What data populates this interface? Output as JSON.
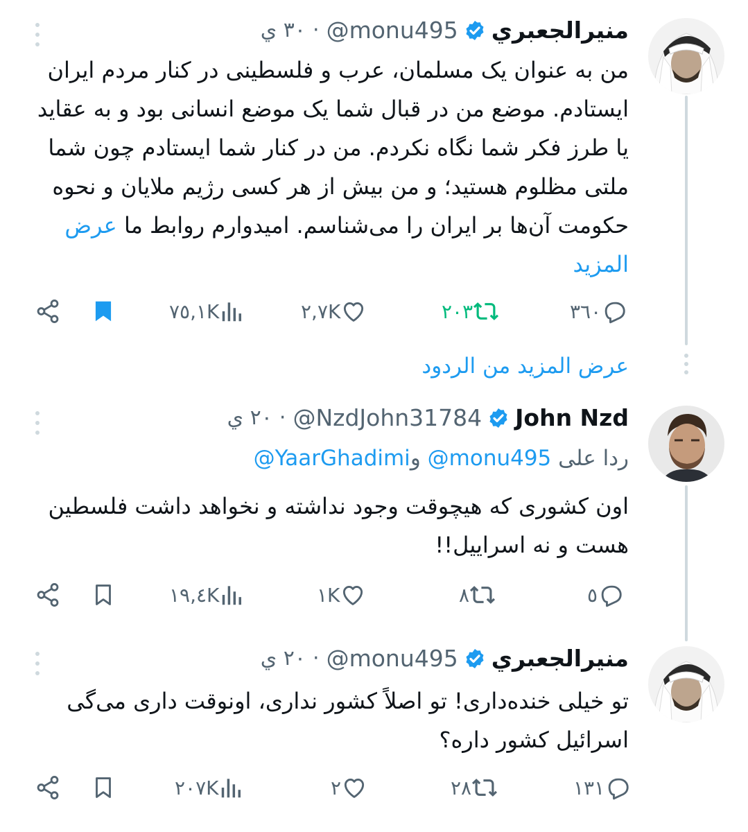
{
  "tweets": [
    {
      "name": "منيرالجعبري",
      "handle": "@monu495",
      "time": "٣٠ ي",
      "text": "من به عنوان یک مسلمان، عرب و فلسطینی در کنار مردم ایران ایستادم. موضع من در قبال شما یک موضع انسانی بود و به عقاید یا طرز فکر شما نگاه نکردم. من در کنار شما ایستادم چون شما ملتی مظلوم هستید؛ و من بیش از هر کسی رژیم ملایان و نحوه حکومت آن‌ها بر ایران را می‌شناسم. امیدوارم روابط ما",
      "show_more": "عرض المزيد",
      "replies": "٣٦٠",
      "retweets": "٢٠٣",
      "likes": "٢,٧K",
      "views": "٧٥,١K",
      "bookmarked": true
    },
    {
      "name": "John Nzd",
      "handle": "@NzdJohn31784",
      "time": "٢٠ ي",
      "reply_prefix": "ردا على",
      "reply_mention1": "@monu495",
      "reply_and": "و",
      "reply_mention2": "@YaarGhadimi",
      "text": "اون کشوری که هیچوقت وجود نداشته و نخواهد داشت فلسطین هست و نه اسراییل!!",
      "replies": "٥",
      "retweets": "٨",
      "likes": "١K",
      "views": "١٩,٤K",
      "bookmarked": false
    },
    {
      "name": "منيرالجعبري",
      "handle": "@monu495",
      "time": "٢٠ ي",
      "text": "تو خیلی خنده‌داری! تو اصلاً کشور نداری، اونوقت داری می‌گی اسرائیل کشور داره؟",
      "replies": "١٣١",
      "retweets": "٢٨",
      "likes": "٢",
      "views": "٢٠٧K",
      "bookmarked": false
    }
  ],
  "more_replies_label": "عرض المزيد من الردود",
  "colors": {
    "accent": "#1d9bf0",
    "retweet_active": "#00ba7c",
    "muted": "#536471",
    "line": "#cfd9de"
  },
  "icons": [
    "reply-icon",
    "retweet-icon",
    "like-icon",
    "views-icon",
    "bookmark-icon",
    "share-icon",
    "verified-badge-icon",
    "more-options-icon"
  ]
}
